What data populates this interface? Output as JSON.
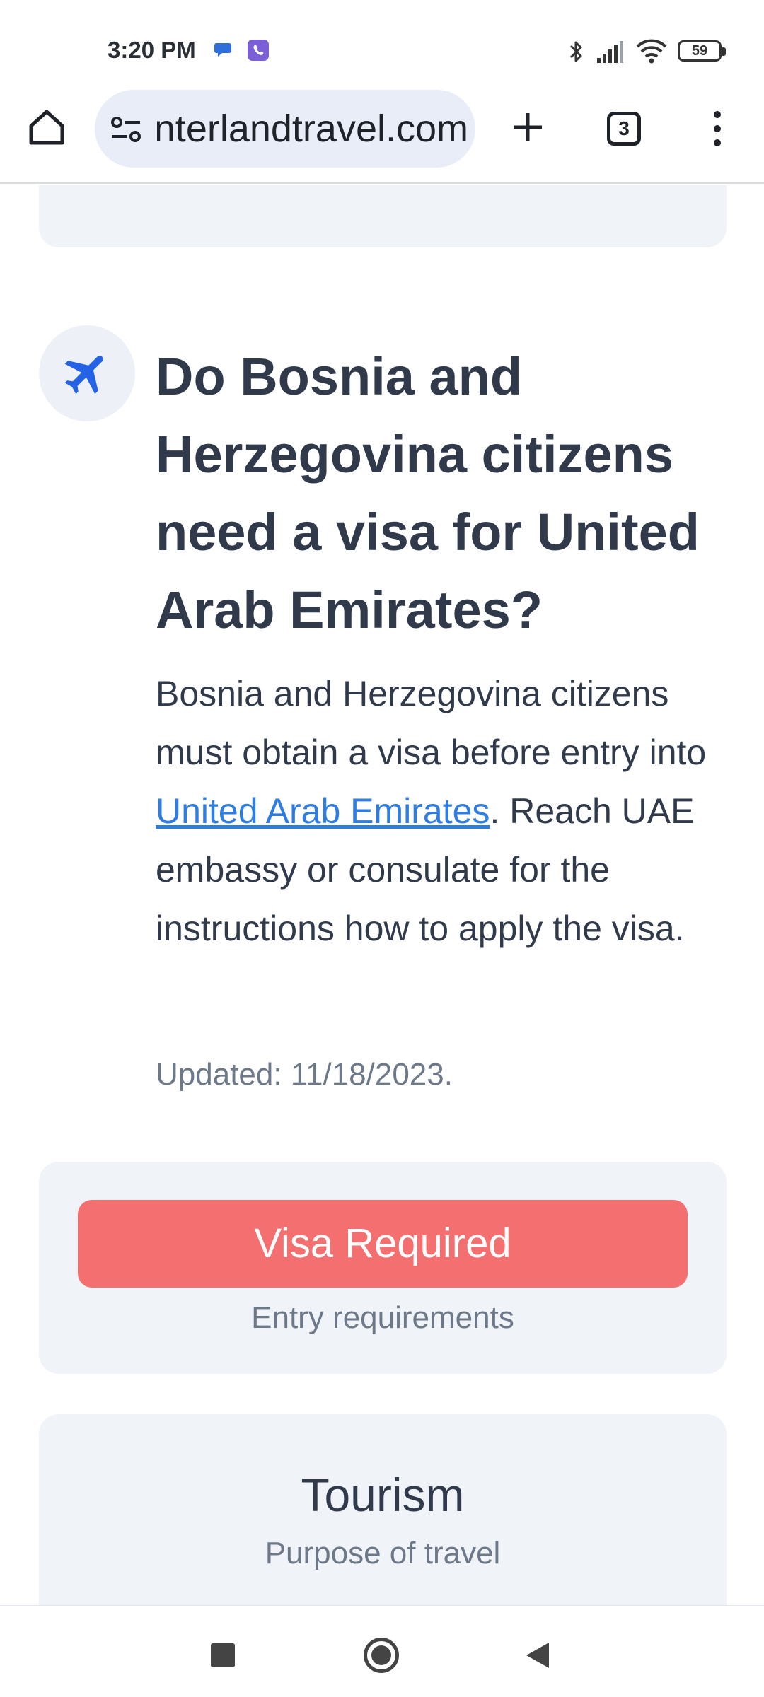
{
  "status_bar": {
    "time": "3:20 PM",
    "battery": "59",
    "icons": [
      "chat-icon",
      "viber-icon",
      "bluetooth-icon",
      "signal-icon",
      "wifi-icon",
      "battery-icon"
    ]
  },
  "browser": {
    "url": "interlandtravel.com",
    "tab_count": "3",
    "icons": [
      "home-icon",
      "site-settings-icon",
      "plus-icon",
      "tabs-icon",
      "more-vert-icon"
    ]
  },
  "article": {
    "icon": "airplane-icon",
    "accent_color": "#2463e6",
    "headline": "Do Bosnia and Herzegovina citizens need a visa for United Arab Emirates?",
    "body_before_link": "Bosnia and Herzegovina citizens must obtain a visa before entry into ",
    "body_link": "United Arab Emirates",
    "body_after_link": ". Reach UAE embassy or consulate for the instructions how to apply the visa.",
    "updated": "Updated: 11/18/2023."
  },
  "visa_card": {
    "status_label": "Visa Required",
    "status_color": "#f36f70",
    "subtitle": "Entry requirements"
  },
  "purpose_card": {
    "title": "Tourism",
    "subtitle": "Purpose of travel"
  },
  "nav_bar": {
    "icons": [
      "recent-apps-icon",
      "home-circle-icon",
      "back-icon"
    ]
  }
}
